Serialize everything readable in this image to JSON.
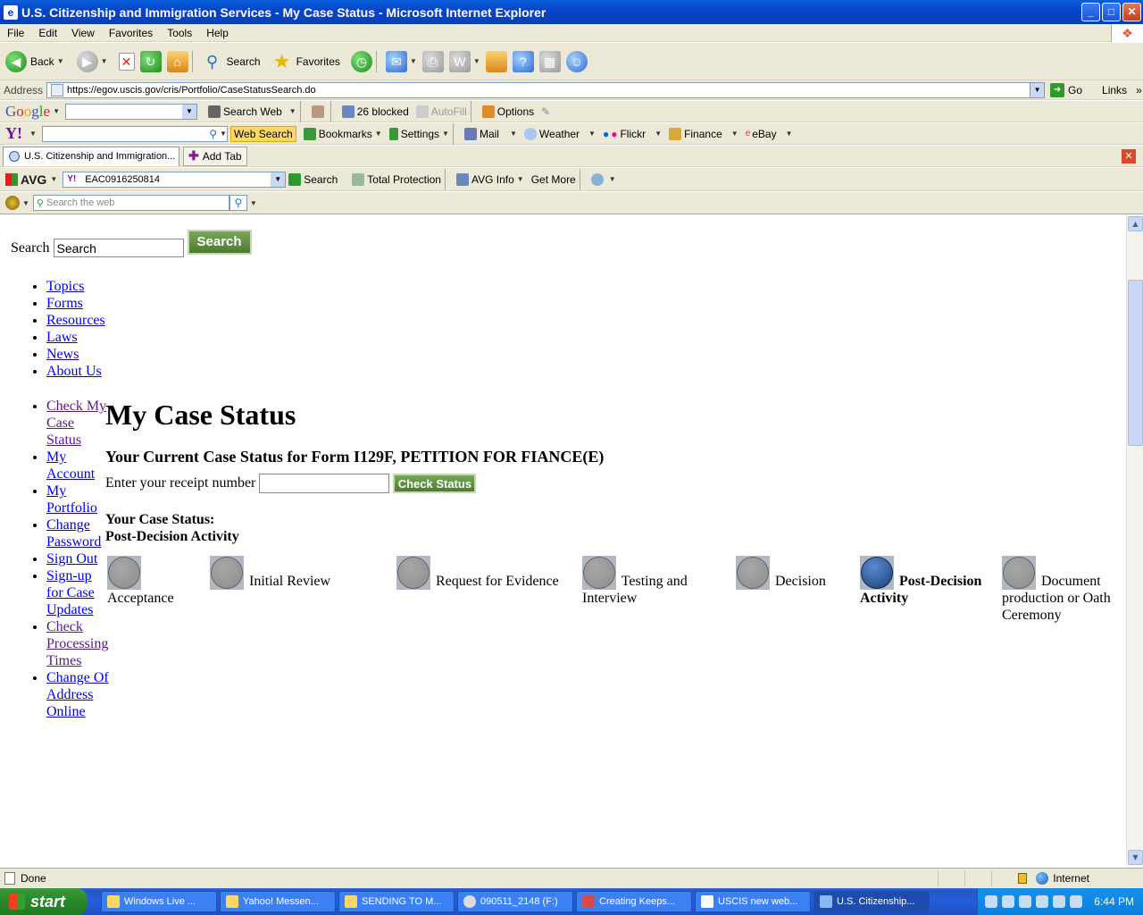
{
  "window": {
    "title": "U.S. Citizenship and Immigration Services - My Case Status - Microsoft Internet Explorer",
    "minimize": "_",
    "maximize": "□",
    "close": "✕"
  },
  "menu": [
    "File",
    "Edit",
    "View",
    "Favorites",
    "Tools",
    "Help"
  ],
  "toolbar": {
    "back": "Back",
    "search": "Search",
    "favorites": "Favorites"
  },
  "address": {
    "label": "Address",
    "url": "https://egov.uscis.gov/cris/Portfolio/CaseStatusSearch.do",
    "go": "Go",
    "links": "Links",
    "more": "»"
  },
  "google_bar": {
    "logo_parts": [
      "G",
      "o",
      "o",
      "g",
      "l",
      "e"
    ],
    "search_web": "Search Web",
    "blocked": "26 blocked",
    "autofill": "AutoFill",
    "options": "Options"
  },
  "yahoo_bar": {
    "logo": "Y!",
    "web_search": "Web Search",
    "bookmarks": "Bookmarks",
    "settings": "Settings",
    "mail": "Mail",
    "weather": "Weather",
    "flickr": "Flickr",
    "finance": "Finance",
    "ebay": "eBay"
  },
  "tabs": {
    "active": "U.S. Citizenship and Immigration...",
    "add": "Add Tab"
  },
  "avg_bar": {
    "logo": "AVG",
    "search_value": "EAC0916250814",
    "search": "Search",
    "total_protection": "Total Protection",
    "avg_info": "AVG Info",
    "get_more": "Get More"
  },
  "web_search_bar": {
    "placeholder": "Search the web"
  },
  "page": {
    "search_label": "Search",
    "search_value": "Search",
    "search_button": "Search",
    "top_nav": [
      "Topics",
      "Forms",
      "Resources",
      "Laws",
      "News",
      "About Us"
    ],
    "side_nav": [
      {
        "label": "Check My Case Status",
        "visited": true
      },
      {
        "label": "My Account",
        "visited": false
      },
      {
        "label": "My Portfolio",
        "visited": false
      },
      {
        "label": "Change Password",
        "visited": false
      },
      {
        "label": "Sign Out",
        "visited": false
      },
      {
        "label": "Sign-up for Case Updates",
        "visited": false
      },
      {
        "label": "Check Processing Times",
        "visited": true
      },
      {
        "label": "Change Of Address Online",
        "visited": false
      }
    ],
    "heading": "My Case Status",
    "subheading": "Your Current Case Status for Form I129F, PETITION FOR FIANCE(E)",
    "receipt_label": "Enter your receipt number",
    "receipt_value": "",
    "check_button": "Check Status",
    "status_label": "Your Case Status:",
    "status_value": "Post-Decision Activity",
    "steps": [
      {
        "label": "Acceptance",
        "current": false
      },
      {
        "label": "Initial Review",
        "current": false
      },
      {
        "label": "Request for Evidence",
        "current": false
      },
      {
        "label": "Testing and Interview",
        "current": false
      },
      {
        "label": "Decision",
        "current": false
      },
      {
        "label": "Post-Decision Activity",
        "current": true
      },
      {
        "label": "Document production or Oath Ceremony",
        "current": false
      }
    ]
  },
  "statusbar": {
    "text": "Done",
    "zone": "Internet"
  },
  "taskbar": {
    "start": "start",
    "tasks": [
      {
        "label": "Windows Live ...",
        "active": false
      },
      {
        "label": "Yahoo! Messen...",
        "active": false
      },
      {
        "label": "SENDING TO M...",
        "active": false
      },
      {
        "label": "090511_2148 (F:)",
        "active": false
      },
      {
        "label": "Creating Keeps...",
        "active": false
      },
      {
        "label": "USCIS new web...",
        "active": false
      },
      {
        "label": "U.S. Citizenship...",
        "active": true
      }
    ],
    "clock": "6:44 PM"
  }
}
